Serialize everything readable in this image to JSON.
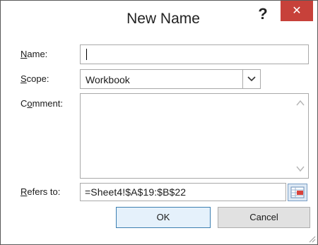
{
  "dialog": {
    "title": "New Name",
    "help_label": "?",
    "close_label": "✕"
  },
  "fields": {
    "name_label": "Name:",
    "name_value": "",
    "scope_label": "Scope:",
    "scope_value": "Workbook",
    "comment_label": "Comment:",
    "comment_value": "",
    "refers_label": "Refers to:",
    "refers_value": "=Sheet4!$A$19:$B$22"
  },
  "buttons": {
    "ok_label": "OK",
    "cancel_label": "Cancel"
  },
  "icons": {
    "select_arrow": "chevron-down-icon",
    "collapse": "collapse-dialog-icon",
    "scroll_up": "chevron-up-icon",
    "scroll_down": "chevron-down-icon",
    "resize": "resize-grip-icon"
  },
  "colors": {
    "close_button": "#c7413a",
    "ok_border": "#3c7fb1"
  }
}
